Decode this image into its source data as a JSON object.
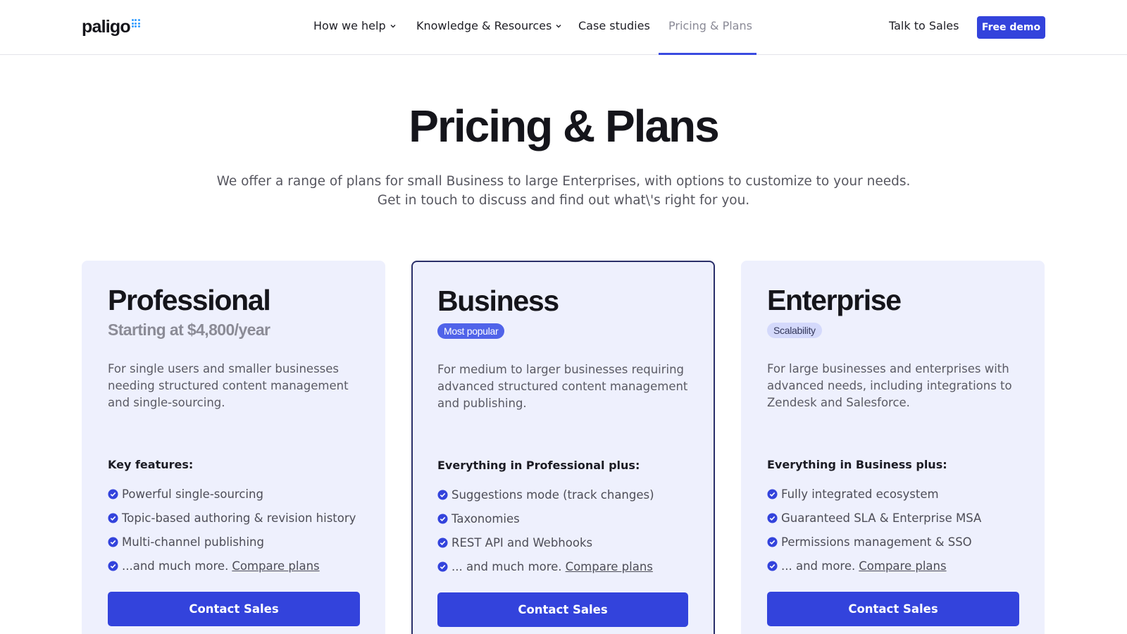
{
  "header": {
    "logo_text": "paligo",
    "nav": [
      {
        "label": "How we help",
        "has_dropdown": true
      },
      {
        "label": "Knowledge & Resources",
        "has_dropdown": true
      },
      {
        "label": "Case studies",
        "has_dropdown": false
      },
      {
        "label": "Pricing & Plans",
        "has_dropdown": false,
        "active": true
      }
    ],
    "talk_label": "Talk to Sales",
    "demo_label": "Free demo"
  },
  "hero": {
    "title": "Pricing & Plans",
    "subtitle_line1": "We offer a range of plans for small Business to large Enterprises, with options to customize to your needs.",
    "subtitle_line2": "Get in touch to discuss and find out what\\'s right for you."
  },
  "plans": [
    {
      "name": "Professional",
      "price": "Starting at $4,800/year",
      "description": "For single users and smaller businesses needing structured content management and single-sourcing.",
      "features_heading": "Key features:",
      "features": [
        "Powerful single-sourcing",
        "Topic-based authoring & revision history",
        "Multi-channel publishing"
      ],
      "more_text": "...and much more.",
      "compare_label": "Compare plans",
      "cta_label": "Contact Sales"
    },
    {
      "name": "Business",
      "badge": "Most popular",
      "description": "For medium to larger businesses requiring advanced structured content management and publishing.",
      "features_heading": "Everything in Professional plus:",
      "features": [
        "Suggestions mode (track changes)",
        "Taxonomies",
        "REST API and Webhooks"
      ],
      "more_text": "... and much more.",
      "compare_label": "Compare plans",
      "cta_label": "Contact Sales"
    },
    {
      "name": "Enterprise",
      "badge": "Scalability",
      "description": "For large businesses and enterprises with advanced needs, including integrations to Zendesk and Salesforce.",
      "features_heading": "Everything in Business plus:",
      "features": [
        "Fully integrated ecosystem",
        "Guaranteed SLA & Enterprise MSA",
        "Permissions management & SSO"
      ],
      "more_text": "... and more.",
      "compare_label": "Compare plans",
      "cta_label": "Contact Sales"
    }
  ],
  "colors": {
    "accent": "#3343dc",
    "card_bg": "#eef0fd",
    "badge_solid": "#5063e9",
    "badge_soft": "#d4d9fb",
    "logo_dots": "#2f9bff"
  }
}
